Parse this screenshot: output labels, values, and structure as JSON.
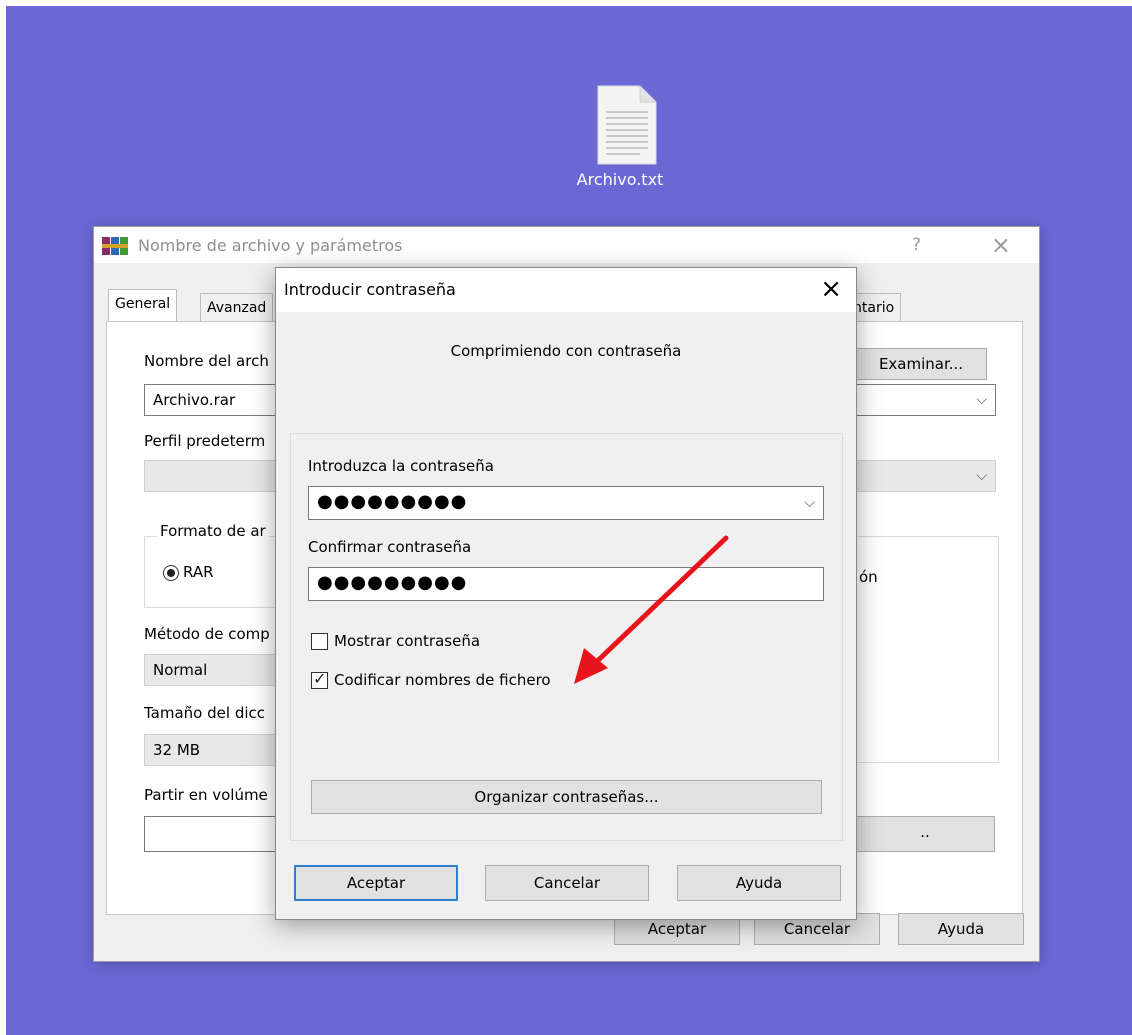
{
  "desktop": {
    "file_label": "Archivo.txt"
  },
  "back_dialog": {
    "title": "Nombre de archivo y parámetros",
    "help": "?",
    "close": "×",
    "tabs": [
      "General",
      "Avanzad",
      "ntario"
    ],
    "archive_name_label": "Nombre del arch",
    "browse_button": "Examinar...",
    "archive_name_value": "Archivo.rar",
    "profile_label": "Perfil predeterm",
    "format_group_label": "Formato de ar",
    "format_rar_label": "RAR",
    "options_text": "ón",
    "method_label": "Método de comp",
    "method_value": "Normal",
    "dict_label": "Tamaño del dicc",
    "dict_value": "32 MB",
    "split_label": "Partir en volúme",
    "partial_button_text": "..",
    "ok": "Aceptar",
    "cancel": "Cancelar",
    "help_button": "Ayuda"
  },
  "password_dialog": {
    "title": "Introducir contraseña",
    "close": "×",
    "subtitle": "Comprimiendo con contraseña",
    "enter_label": "Introduzca la contraseña",
    "enter_value": "●●●●●●●●●",
    "confirm_label": "Confirmar contraseña",
    "confirm_value": "●●●●●●●●●",
    "show_password_label": "Mostrar contraseña",
    "show_password_checked": false,
    "encrypt_names_label": "Codificar nombres de fichero",
    "encrypt_names_checked": true,
    "organize_button": "Organizar contraseñas...",
    "ok": "Aceptar",
    "cancel": "Cancelar",
    "help_button": "Ayuda"
  },
  "annotation": {
    "arrow_color": "#e8141b"
  },
  "colors": {
    "desktop": "#6b68d6",
    "dialog_bg": "#f0f0f0",
    "focus_border": "#2f7fd1"
  }
}
